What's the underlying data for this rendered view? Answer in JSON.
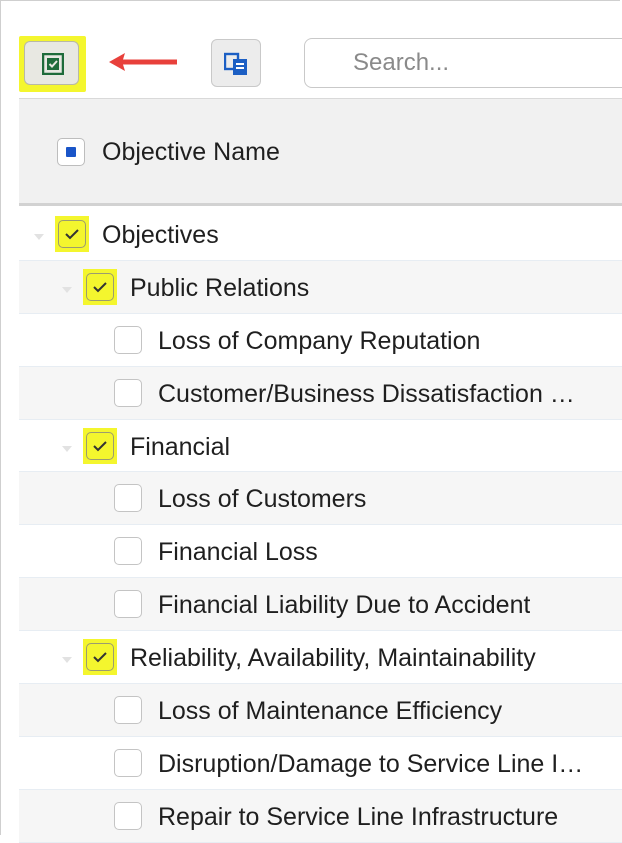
{
  "toolbar": {
    "select_all_icon": "checkbox-select-icon",
    "arrow_icon": "arrow-left-icon",
    "arrow_color": "#e8403b",
    "copy_icon": "copy-icon",
    "search": {
      "placeholder": "Search...",
      "value": ""
    },
    "highlight_color": "#f4f62e"
  },
  "header": {
    "column_label": "Objective Name",
    "checkbox_state": "indeterminate"
  },
  "tree": {
    "rows": [
      {
        "label": "Objectives",
        "level": 0,
        "checked": true,
        "expandable": true
      },
      {
        "label": "Public Relations",
        "level": 1,
        "checked": true,
        "expandable": true
      },
      {
        "label": "Loss of Company Reputation",
        "level": 2,
        "checked": false,
        "expandable": false
      },
      {
        "label": "Customer/Business Dissatisfaction …",
        "level": 2,
        "checked": false,
        "expandable": false
      },
      {
        "label": "Financial",
        "level": 1,
        "checked": true,
        "expandable": true
      },
      {
        "label": "Loss of Customers",
        "level": 2,
        "checked": false,
        "expandable": false
      },
      {
        "label": "Financial Loss",
        "level": 2,
        "checked": false,
        "expandable": false
      },
      {
        "label": "Financial Liability Due to Accident",
        "level": 2,
        "checked": false,
        "expandable": false
      },
      {
        "label": "Reliability, Availability, Maintainability",
        "level": 1,
        "checked": true,
        "expandable": true
      },
      {
        "label": "Loss of Maintenance Efficiency",
        "level": 2,
        "checked": false,
        "expandable": false
      },
      {
        "label": "Disruption/Damage to Service Line I…",
        "level": 2,
        "checked": false,
        "expandable": false
      },
      {
        "label": "Repair to Service Line Infrastructure",
        "level": 2,
        "checked": false,
        "expandable": false
      }
    ]
  }
}
